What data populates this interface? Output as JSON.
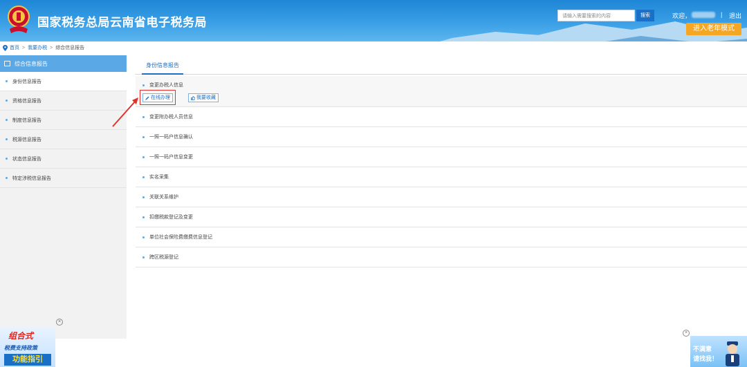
{
  "header": {
    "title": "国家税务总局云南省电子税务局",
    "search_placeholder": "请输入需要搜索的内容",
    "search_button": "搜索",
    "welcome": "欢迎，",
    "separator": "|",
    "logout": "退出",
    "elder_mode": "进入老年模式"
  },
  "breadcrumb": {
    "home": "首页",
    "sep": ">",
    "level2": "我要办税",
    "level3": "综合信息报告"
  },
  "sidebar": {
    "title": "综合信息报告",
    "items": [
      {
        "label": "身份信息报告",
        "active": true
      },
      {
        "label": "资格信息报告"
      },
      {
        "label": "制度信息报告"
      },
      {
        "label": "税源信息报告"
      },
      {
        "label": "状态信息报告"
      },
      {
        "label": "特定涉税信息报告"
      }
    ],
    "close": "×"
  },
  "main": {
    "tab": "身份信息报告",
    "items": [
      {
        "label": "变更办税人信息",
        "expanded": true
      },
      {
        "label": "变更附办税人员信息"
      },
      {
        "label": "一照一码户信息确认"
      },
      {
        "label": "一照一码户信息变更"
      },
      {
        "label": "实名采集"
      },
      {
        "label": "关联关系维护"
      },
      {
        "label": "扣缴税款登记及变更"
      },
      {
        "label": "单位社会保险费缴费信息登记"
      },
      {
        "label": "跨区税源登记"
      }
    ],
    "online_handle": "在线办理",
    "favorite": "我要收藏"
  },
  "promo_left": {
    "line1": "组合式",
    "line2": "税费支持政策",
    "line3": "功能指引",
    "close": "×"
  },
  "promo_right": {
    "line1": "不满意",
    "line2": "请找我！",
    "close": "×"
  },
  "colors": {
    "accent": "#1a6fc6",
    "header_bg": "#2b8fdf",
    "sidebar_head": "#5aa8e6",
    "elder_button": "#f5a623",
    "highlight": "#e0322a"
  }
}
